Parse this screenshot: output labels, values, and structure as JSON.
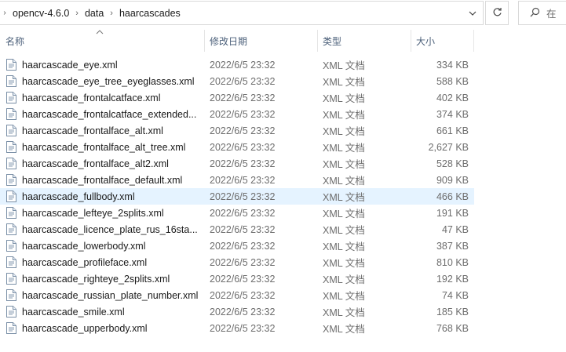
{
  "address_bar": {
    "crumbs": [
      "opencv-4.6.0",
      "data",
      "haarcascades"
    ]
  },
  "search": {
    "placeholder": "在 "
  },
  "columns": {
    "name": "名称",
    "date": "修改日期",
    "type": "类型",
    "size": "大小"
  },
  "files": [
    {
      "name": "haarcascade_eye.xml",
      "date": "2022/6/5 23:32",
      "type": "XML 文档",
      "size": "334 KB"
    },
    {
      "name": "haarcascade_eye_tree_eyeglasses.xml",
      "date": "2022/6/5 23:32",
      "type": "XML 文档",
      "size": "588 KB"
    },
    {
      "name": "haarcascade_frontalcatface.xml",
      "date": "2022/6/5 23:32",
      "type": "XML 文档",
      "size": "402 KB"
    },
    {
      "name": "haarcascade_frontalcatface_extended...",
      "date": "2022/6/5 23:32",
      "type": "XML 文档",
      "size": "374 KB"
    },
    {
      "name": "haarcascade_frontalface_alt.xml",
      "date": "2022/6/5 23:32",
      "type": "XML 文档",
      "size": "661 KB"
    },
    {
      "name": "haarcascade_frontalface_alt_tree.xml",
      "date": "2022/6/5 23:32",
      "type": "XML 文档",
      "size": "2,627 KB"
    },
    {
      "name": "haarcascade_frontalface_alt2.xml",
      "date": "2022/6/5 23:32",
      "type": "XML 文档",
      "size": "528 KB"
    },
    {
      "name": "haarcascade_frontalface_default.xml",
      "date": "2022/6/5 23:32",
      "type": "XML 文档",
      "size": "909 KB"
    },
    {
      "name": "haarcascade_fullbody.xml",
      "date": "2022/6/5 23:32",
      "type": "XML 文档",
      "size": "466 KB"
    },
    {
      "name": "haarcascade_lefteye_2splits.xml",
      "date": "2022/6/5 23:32",
      "type": "XML 文档",
      "size": "191 KB"
    },
    {
      "name": "haarcascade_licence_plate_rus_16sta...",
      "date": "2022/6/5 23:32",
      "type": "XML 文档",
      "size": "47 KB"
    },
    {
      "name": "haarcascade_lowerbody.xml",
      "date": "2022/6/5 23:32",
      "type": "XML 文档",
      "size": "387 KB"
    },
    {
      "name": "haarcascade_profileface.xml",
      "date": "2022/6/5 23:32",
      "type": "XML 文档",
      "size": "810 KB"
    },
    {
      "name": "haarcascade_righteye_2splits.xml",
      "date": "2022/6/5 23:32",
      "type": "XML 文档",
      "size": "192 KB"
    },
    {
      "name": "haarcascade_russian_plate_number.xml",
      "date": "2022/6/5 23:32",
      "type": "XML 文档",
      "size": "74 KB"
    },
    {
      "name": "haarcascade_smile.xml",
      "date": "2022/6/5 23:32",
      "type": "XML 文档",
      "size": "185 KB"
    },
    {
      "name": "haarcascade_upperbody.xml",
      "date": "2022/6/5 23:32",
      "type": "XML 文档",
      "size": "768 KB"
    }
  ],
  "hovered_row": 8,
  "icons": {
    "file": "xml-file-icon",
    "refresh": "refresh-icon",
    "search": "search-icon",
    "dropdown": "chevron-down-icon",
    "sort": "sort-up-icon"
  },
  "colors": {
    "hover_row": "#e5f3ff",
    "header_text": "#4c607a",
    "secondary_text": "#6d6d6d"
  }
}
